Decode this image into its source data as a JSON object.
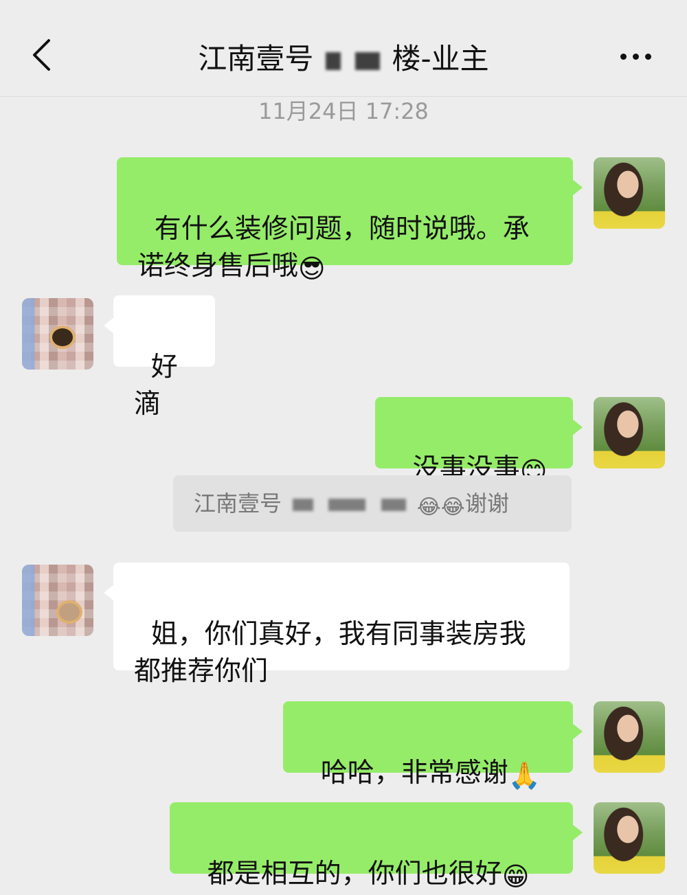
{
  "header": {
    "title_prefix": "江南壹号",
    "title_suffix": "楼-业主"
  },
  "timestamp": "11月24日 17:28",
  "messages": [
    {
      "sender": "self",
      "text": "有什么装修问题，随时说哦。承诺终身售后哦",
      "emoji": "😎"
    },
    {
      "sender": "other",
      "text": "好滴",
      "emoji": ""
    },
    {
      "sender": "self",
      "text": "没事没事",
      "emoji": "😊"
    },
    {
      "sender": "other",
      "text": "姐，你们真好，我有同事装房我都推荐你们",
      "emoji": ""
    },
    {
      "sender": "self",
      "text": "哈哈，非常感谢",
      "emoji": "🙏"
    },
    {
      "sender": "self",
      "text": "都是相互的，你们也很好",
      "emoji": "😁"
    }
  ],
  "quote": {
    "prefix": "江南壹号",
    "emoji": "😂😂",
    "suffix": "谢谢"
  }
}
